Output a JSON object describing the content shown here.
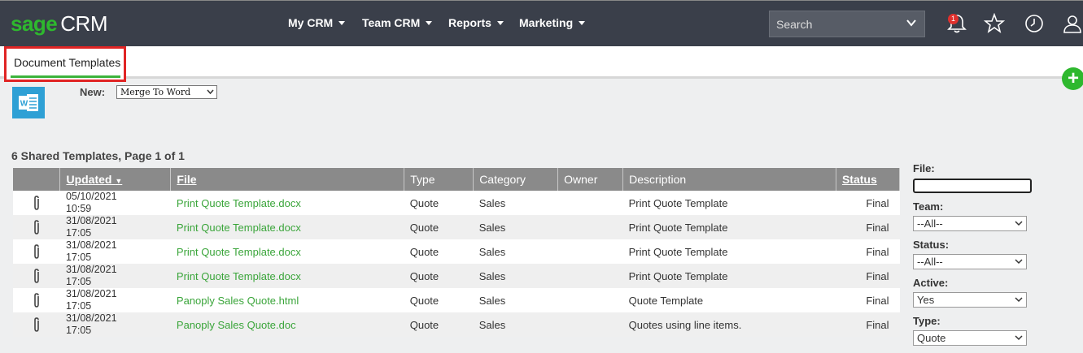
{
  "header": {
    "logo_brand": "sage",
    "logo_product": "CRM",
    "nav": [
      {
        "label": "My CRM"
      },
      {
        "label": "Team CRM"
      },
      {
        "label": "Reports"
      },
      {
        "label": "Marketing"
      }
    ],
    "search_placeholder": "Search",
    "notification_count": "1"
  },
  "tabs": [
    {
      "label": "Document Templates",
      "active": true
    }
  ],
  "new_section": {
    "label": "New:",
    "selected": "Merge To Word"
  },
  "list_title": "6 Shared Templates, Page 1 of 1",
  "table": {
    "columns": [
      "",
      "Updated",
      "File",
      "Type",
      "Category",
      "Owner",
      "Description",
      "Status"
    ],
    "rows": [
      {
        "updated_date": "05/10/2021",
        "updated_time": "10:59",
        "file": "Print Quote Template.docx",
        "type": "Quote",
        "category": "Sales",
        "owner": "",
        "description": "Print Quote Template",
        "status": "Final"
      },
      {
        "updated_date": "31/08/2021",
        "updated_time": "17:05",
        "file": "Print Quote Template.docx",
        "type": "Quote",
        "category": "Sales",
        "owner": "",
        "description": "Print Quote Template",
        "status": "Final"
      },
      {
        "updated_date": "31/08/2021",
        "updated_time": "17:05",
        "file": "Print Quote Template.docx",
        "type": "Quote",
        "category": "Sales",
        "owner": "",
        "description": "Print Quote Template",
        "status": "Final"
      },
      {
        "updated_date": "31/08/2021",
        "updated_time": "17:05",
        "file": "Print Quote Template.docx",
        "type": "Quote",
        "category": "Sales",
        "owner": "",
        "description": "Print Quote Template",
        "status": "Final"
      },
      {
        "updated_date": "31/08/2021",
        "updated_time": "17:05",
        "file": "Panoply Sales Quote.html",
        "type": "Quote",
        "category": "Sales",
        "owner": "",
        "description": "Quote Template",
        "status": "Final"
      },
      {
        "updated_date": "31/08/2021",
        "updated_time": "17:05",
        "file": "Panoply Sales Quote.doc",
        "type": "Quote",
        "category": "Sales",
        "owner": "",
        "description": "Quotes using line items.",
        "status": "Final"
      }
    ]
  },
  "filters": {
    "file_label": "File:",
    "file_value": "",
    "team_label": "Team:",
    "team_value": "--All--",
    "status_label": "Status:",
    "status_value": "--All--",
    "active_label": "Active:",
    "active_value": "Yes",
    "type_label": "Type:",
    "type_value": "Quote"
  },
  "colors": {
    "brand_green": "#2eb82e",
    "topbar": "#3a3f4a",
    "highlight_red": "#e02424",
    "link_green": "#3aa53a"
  }
}
